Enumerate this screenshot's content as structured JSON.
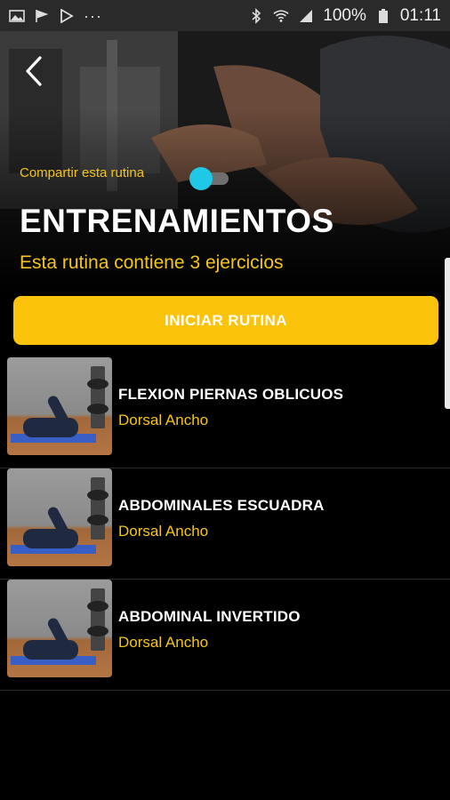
{
  "status_bar": {
    "left_icons": [
      "image-icon",
      "flag-icon",
      "play-icon",
      "more-dots-icon"
    ],
    "right_icons": [
      "bluetooth-icon",
      "wifi-icon",
      "signal-icon"
    ],
    "battery": "100%",
    "time": "01:11"
  },
  "header": {
    "share_label": "Compartir esta rutina",
    "share_toggle_on": true,
    "title": "ENTRENAMIENTOS",
    "subtitle": "Esta rutina contiene 3 ejercicios"
  },
  "actions": {
    "start_label": "INICIAR RUTINA"
  },
  "exercises": [
    {
      "name": "FLEXION PIERNAS OBLICUOS",
      "muscle": "Dorsal Ancho"
    },
    {
      "name": "ABDOMINALES ESCUADRA",
      "muscle": "Dorsal Ancho"
    },
    {
      "name": "ABDOMINAL INVERTIDO",
      "muscle": "Dorsal Ancho"
    }
  ],
  "colors": {
    "accent": "#fcc30b",
    "accent_text": "#f5c518",
    "toggle_knob": "#1ec8e6",
    "background": "#000000"
  }
}
